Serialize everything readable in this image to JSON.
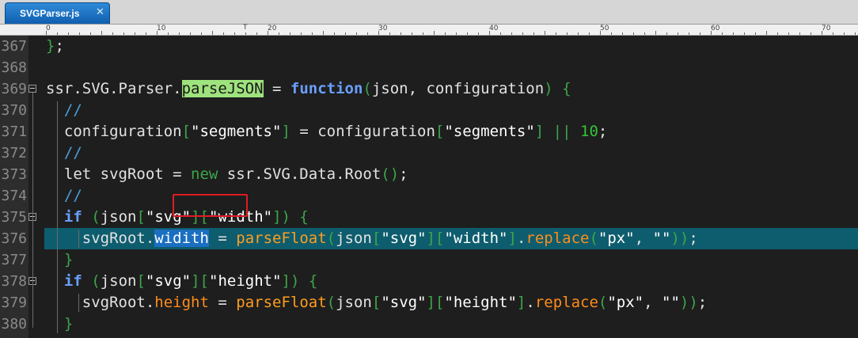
{
  "tab": {
    "title": "SVGParser.js",
    "close_glyph": "✕"
  },
  "ruler": {
    "marks": [
      "0",
      "10",
      "20",
      "30",
      "40",
      "50",
      "60",
      "70"
    ],
    "cursor_glyph": "T"
  },
  "lines": [
    {
      "n": "367",
      "tokens": [
        [
          "brk",
          "}"
        ],
        [
          "op",
          ";"
        ]
      ]
    },
    {
      "n": "368",
      "tokens": []
    },
    {
      "n": "369",
      "fold": true,
      "tokens": [
        [
          "op",
          "ssr.SVG.Parser."
        ],
        [
          "sel",
          "parseJSON"
        ],
        [
          "op",
          " = "
        ],
        [
          "kw",
          "function"
        ],
        [
          "brk",
          "("
        ],
        [
          "op",
          "json, configuration"
        ],
        [
          "brk",
          ")"
        ],
        [
          "op",
          " "
        ],
        [
          "brk",
          "{"
        ]
      ]
    },
    {
      "n": "370",
      "tokens": [
        [
          "op",
          "  "
        ],
        [
          "cm",
          "//"
        ]
      ]
    },
    {
      "n": "371",
      "tokens": [
        [
          "op",
          "  configuration"
        ],
        [
          "brk",
          "["
        ],
        [
          "str",
          "\"segments\""
        ],
        [
          "brk",
          "]"
        ],
        [
          "op",
          " = configuration"
        ],
        [
          "brk",
          "["
        ],
        [
          "str",
          "\"segments\""
        ],
        [
          "brk",
          "]"
        ],
        [
          "op",
          " "
        ],
        [
          "brk",
          "||"
        ],
        [
          "op",
          " "
        ],
        [
          "num",
          "10"
        ],
        [
          "op",
          ";"
        ]
      ]
    },
    {
      "n": "372",
      "tokens": [
        [
          "op",
          "  "
        ],
        [
          "cm",
          "//"
        ]
      ]
    },
    {
      "n": "373",
      "tokens": [
        [
          "op",
          "  let svgRoot = "
        ],
        [
          "brk",
          "new"
        ],
        [
          "op",
          " ssr.SVG.Data.Root"
        ],
        [
          "brk",
          "()"
        ],
        [
          "op",
          ";"
        ]
      ]
    },
    {
      "n": "374",
      "tokens": [
        [
          "op",
          "  "
        ],
        [
          "cm",
          "//"
        ]
      ]
    },
    {
      "n": "375",
      "fold": true,
      "tokens": [
        [
          "op",
          "  "
        ],
        [
          "kw",
          "if"
        ],
        [
          "op",
          " "
        ],
        [
          "brk",
          "("
        ],
        [
          "op",
          "json"
        ],
        [
          "brk",
          "["
        ],
        [
          "str",
          "\"svg\""
        ],
        [
          "brk",
          "]["
        ],
        [
          "str",
          "\"width\""
        ],
        [
          "brk",
          "])"
        ],
        [
          "op",
          " "
        ],
        [
          "brk",
          "{"
        ]
      ]
    },
    {
      "n": "376",
      "current": true,
      "tokens": [
        [
          "op",
          "    svgRoot."
        ],
        [
          "word",
          "widith"
        ],
        [
          "op",
          " = "
        ],
        [
          "fn",
          "parseFloat"
        ],
        [
          "brk",
          "("
        ],
        [
          "op",
          "json"
        ],
        [
          "brk",
          "["
        ],
        [
          "str",
          "\"svg\""
        ],
        [
          "brk",
          "]["
        ],
        [
          "str",
          "\"width\""
        ],
        [
          "brk",
          "]"
        ],
        [
          "op",
          "."
        ],
        [
          "prop",
          "replace"
        ],
        [
          "brk",
          "("
        ],
        [
          "str",
          "\"px\""
        ],
        [
          "op",
          ", "
        ],
        [
          "str",
          "\"\""
        ],
        [
          "brk",
          "))"
        ],
        [
          "op",
          ";"
        ]
      ]
    },
    {
      "n": "377",
      "tokens": [
        [
          "op",
          "  "
        ],
        [
          "brk",
          "}"
        ]
      ]
    },
    {
      "n": "378",
      "fold": true,
      "tokens": [
        [
          "op",
          "  "
        ],
        [
          "kw",
          "if"
        ],
        [
          "op",
          " "
        ],
        [
          "brk",
          "("
        ],
        [
          "op",
          "json"
        ],
        [
          "brk",
          "["
        ],
        [
          "str",
          "\"svg\""
        ],
        [
          "brk",
          "]["
        ],
        [
          "str",
          "\"height\""
        ],
        [
          "brk",
          "])"
        ],
        [
          "op",
          " "
        ],
        [
          "brk",
          "{"
        ]
      ]
    },
    {
      "n": "379",
      "tokens": [
        [
          "op",
          "    svgRoot."
        ],
        [
          "prop",
          "height"
        ],
        [
          "op",
          " = "
        ],
        [
          "fn",
          "parseFloat"
        ],
        [
          "brk",
          "("
        ],
        [
          "op",
          "json"
        ],
        [
          "brk",
          "["
        ],
        [
          "str",
          "\"svg\""
        ],
        [
          "brk",
          "]["
        ],
        [
          "str",
          "\"height\""
        ],
        [
          "brk",
          "]"
        ],
        [
          "op",
          "."
        ],
        [
          "prop",
          "replace"
        ],
        [
          "brk",
          "("
        ],
        [
          "str",
          "\"px\""
        ],
        [
          "op",
          ", "
        ],
        [
          "str",
          "\"\""
        ],
        [
          "brk",
          "))"
        ],
        [
          "op",
          ";"
        ]
      ]
    },
    {
      "n": "380",
      "tokens": [
        [
          "op",
          "  "
        ],
        [
          "brk",
          "}"
        ]
      ]
    }
  ],
  "colors": {
    "editor_bg": "#1e1e1e",
    "current_line": "#0e5d6e",
    "keyword": "#6a9fff",
    "bracket": "#3da54a",
    "function": "#ff9d1e",
    "selection": "#9ee37d",
    "annotation": "#e01b24"
  }
}
